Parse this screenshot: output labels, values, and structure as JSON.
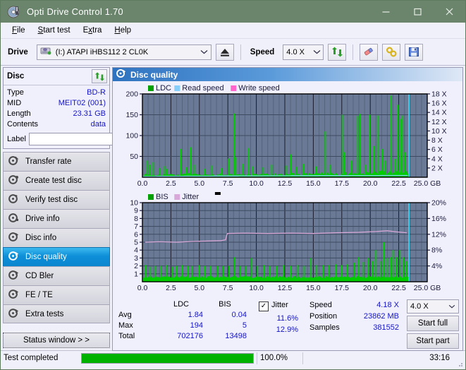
{
  "window": {
    "title": "Opti Drive Control 1.70",
    "icon": "disc-icon",
    "minimize": "—",
    "maximize": "□",
    "close": "✕"
  },
  "menu": [
    {
      "label": "File",
      "accel": "F"
    },
    {
      "label": "Start test",
      "accel": "S"
    },
    {
      "label": "Extra",
      "accel": "x"
    },
    {
      "label": "Help",
      "accel": "H"
    }
  ],
  "toolbar": {
    "drive_label": "Drive",
    "drive_value": "(I:)  ATAPI iHBS112  2 CL0K",
    "eject_icon": "eject-icon",
    "speed_label": "Speed",
    "speed_value": "4.0 X",
    "refresh_icon": "refresh-icon",
    "erase_icon": "eraser-icon",
    "tools_icon": "tools-icon",
    "save_icon": "save-icon"
  },
  "disc": {
    "title": "Disc",
    "refresh_icon": "refresh-icon",
    "rows": [
      {
        "key": "Type",
        "value": "BD-R"
      },
      {
        "key": "MID",
        "value": "MEIT02 (001)"
      },
      {
        "key": "Length",
        "value": "23.31 GB"
      },
      {
        "key": "Contents",
        "value": "data"
      }
    ],
    "label_key": "Label",
    "label_value": "",
    "label_placeholder": "",
    "disc_icon": "disc-icon"
  },
  "sidebar": {
    "items": [
      {
        "label": "Transfer rate",
        "icon": "disc-test-icon",
        "active": false
      },
      {
        "label": "Create test disc",
        "icon": "disc-test-icon",
        "active": false
      },
      {
        "label": "Verify test disc",
        "icon": "disc-test-icon",
        "active": false
      },
      {
        "label": "Drive info",
        "icon": "disc-test-icon",
        "active": false
      },
      {
        "label": "Disc info",
        "icon": "disc-test-icon",
        "active": false
      },
      {
        "label": "Disc quality",
        "icon": "disc-test-icon",
        "active": true
      },
      {
        "label": "CD Bler",
        "icon": "disc-test-icon",
        "active": false
      },
      {
        "label": "FE / TE",
        "icon": "disc-test-icon",
        "active": false
      },
      {
        "label": "Extra tests",
        "icon": "disc-test-icon",
        "active": false
      }
    ],
    "status_window_button": "Status window > >"
  },
  "panel": {
    "title": "Disc quality",
    "icon": "disc-quality-icon"
  },
  "stats": {
    "headers": [
      "LDC",
      "BIS"
    ],
    "rows": [
      {
        "key": "Avg",
        "ldc": "1.84",
        "bis": "0.04",
        "jitter": "11.6%"
      },
      {
        "key": "Max",
        "ldc": "194",
        "bis": "5",
        "jitter": "12.9%"
      },
      {
        "key": "Total",
        "ldc": "702176",
        "bis": "13498",
        "jitter": ""
      }
    ],
    "jitter_label": "Jitter",
    "jitter_checked": true,
    "speed_label": "Speed",
    "speed_value": "4.18 X",
    "position_label": "Position",
    "position_value": "23862 MB",
    "samples_label": "Samples",
    "samples_value": "381552",
    "speed_select": "4.0 X",
    "start_full": "Start full",
    "start_part": "Start part"
  },
  "statusbar": {
    "message": "Test completed",
    "progress_percent": 100.0,
    "progress_text": "100.0%",
    "elapsed": "33:16"
  },
  "chart_data": [
    {
      "type": "line",
      "title": "LDC / Read speed",
      "legend": [
        {
          "name": "LDC",
          "color": "#00a000"
        },
        {
          "name": "Read speed",
          "color": "#87cefa"
        },
        {
          "name": "Write speed",
          "color": "#ff66cc"
        }
      ],
      "legend_position": "top-left",
      "xlabel": "GB",
      "ylabel": "LDC",
      "y2label": "X",
      "xlim": [
        0,
        25
      ],
      "ylim": [
        0,
        200
      ],
      "y2lim": [
        0,
        18
      ],
      "grid": true,
      "xticks": [
        "0.0",
        "2.5",
        "5.0",
        "7.5",
        "10.0",
        "12.5",
        "15.0",
        "17.5",
        "20.0",
        "22.5",
        "25.0 GB"
      ],
      "yticks": [
        50,
        100,
        150,
        200
      ],
      "y2ticks": [
        "2 X",
        "4 X",
        "6 X",
        "8 X",
        "10 X",
        "12 X",
        "14 X",
        "16 X",
        "18 X"
      ],
      "data_end_gb": 23.4,
      "series": [
        {
          "name": "LDC",
          "color": "#00cc00",
          "type": "spike-area",
          "baseline": [
            {
              "x": 0.0,
              "y": 7
            },
            {
              "x": 1.0,
              "y": 6
            },
            {
              "x": 2.0,
              "y": 6
            },
            {
              "x": 3.0,
              "y": 7
            },
            {
              "x": 4.0,
              "y": 8
            },
            {
              "x": 5.0,
              "y": 7
            },
            {
              "x": 6.0,
              "y": 6
            },
            {
              "x": 7.0,
              "y": 7
            },
            {
              "x": 8.0,
              "y": 8
            },
            {
              "x": 9.0,
              "y": 7
            },
            {
              "x": 10.0,
              "y": 7
            },
            {
              "x": 11.0,
              "y": 7
            },
            {
              "x": 12.0,
              "y": 8
            },
            {
              "x": 13.0,
              "y": 8
            },
            {
              "x": 14.0,
              "y": 8
            },
            {
              "x": 15.0,
              "y": 9
            },
            {
              "x": 16.0,
              "y": 9
            },
            {
              "x": 17.0,
              "y": 9
            },
            {
              "x": 18.0,
              "y": 10
            },
            {
              "x": 19.0,
              "y": 11
            },
            {
              "x": 20.0,
              "y": 12
            },
            {
              "x": 21.0,
              "y": 13
            },
            {
              "x": 22.0,
              "y": 13
            },
            {
              "x": 23.0,
              "y": 14
            },
            {
              "x": 23.4,
              "y": 12
            }
          ],
          "spikes": [
            {
              "x": 0.45,
              "y": 40
            },
            {
              "x": 0.62,
              "y": 30
            },
            {
              "x": 0.95,
              "y": 36
            },
            {
              "x": 1.55,
              "y": 22
            },
            {
              "x": 1.95,
              "y": 27
            },
            {
              "x": 2.15,
              "y": 20
            },
            {
              "x": 3.35,
              "y": 68
            },
            {
              "x": 3.85,
              "y": 24
            },
            {
              "x": 4.25,
              "y": 72
            },
            {
              "x": 4.55,
              "y": 30
            },
            {
              "x": 5.45,
              "y": 20
            },
            {
              "x": 6.05,
              "y": 28
            },
            {
              "x": 6.95,
              "y": 22
            },
            {
              "x": 7.55,
              "y": 45
            },
            {
              "x": 8.05,
              "y": 153
            },
            {
              "x": 8.15,
              "y": 48
            },
            {
              "x": 8.85,
              "y": 32
            },
            {
              "x": 9.35,
              "y": 70
            },
            {
              "x": 9.65,
              "y": 26
            },
            {
              "x": 10.6,
              "y": 24
            },
            {
              "x": 11.35,
              "y": 30
            },
            {
              "x": 12.6,
              "y": 28
            },
            {
              "x": 13.05,
              "y": 55
            },
            {
              "x": 13.55,
              "y": 25
            },
            {
              "x": 14.15,
              "y": 32
            },
            {
              "x": 15.25,
              "y": 26
            },
            {
              "x": 16.05,
              "y": 110
            },
            {
              "x": 16.45,
              "y": 30
            },
            {
              "x": 17.55,
              "y": 150
            },
            {
              "x": 17.75,
              "y": 60
            },
            {
              "x": 18.35,
              "y": 40
            },
            {
              "x": 18.9,
              "y": 147
            },
            {
              "x": 19.1,
              "y": 152
            },
            {
              "x": 19.55,
              "y": 30
            },
            {
              "x": 19.95,
              "y": 150
            },
            {
              "x": 20.35,
              "y": 75
            },
            {
              "x": 20.65,
              "y": 148
            },
            {
              "x": 21.05,
              "y": 68
            },
            {
              "x": 21.35,
              "y": 40
            },
            {
              "x": 21.85,
              "y": 196
            },
            {
              "x": 22.15,
              "y": 44
            },
            {
              "x": 22.45,
              "y": 174
            },
            {
              "x": 22.65,
              "y": 140
            },
            {
              "x": 22.85,
              "y": 148
            },
            {
              "x": 23.05,
              "y": 60
            }
          ]
        },
        {
          "name": "Read speed",
          "color": "#87cefa",
          "type": "step-line",
          "points": [
            {
              "x": 0.0,
              "y": 1.75
            },
            {
              "x": 1.2,
              "y": 1.8
            },
            {
              "x": 1.3,
              "y": 2.1
            },
            {
              "x": 3.6,
              "y": 2.15
            },
            {
              "x": 3.7,
              "y": 2.5
            },
            {
              "x": 6.2,
              "y": 2.55
            },
            {
              "x": 6.3,
              "y": 2.85
            },
            {
              "x": 8.4,
              "y": 2.9
            },
            {
              "x": 8.5,
              "y": 3.15
            },
            {
              "x": 10.6,
              "y": 3.2
            },
            {
              "x": 10.7,
              "y": 3.45
            },
            {
              "x": 13.0,
              "y": 3.5
            },
            {
              "x": 13.1,
              "y": 3.7
            },
            {
              "x": 15.4,
              "y": 3.72
            },
            {
              "x": 15.5,
              "y": 3.9
            },
            {
              "x": 18.2,
              "y": 3.92
            },
            {
              "x": 18.3,
              "y": 4.05
            },
            {
              "x": 20.8,
              "y": 4.08
            },
            {
              "x": 20.9,
              "y": 4.2
            },
            {
              "x": 23.3,
              "y": 4.2
            }
          ]
        },
        {
          "name": "marker",
          "color": "#40d8f8",
          "type": "vline",
          "x": 23.4
        }
      ]
    },
    {
      "type": "line",
      "title": "BIS / Jitter",
      "legend": [
        {
          "name": "BIS",
          "color": "#00a000"
        },
        {
          "name": "Jitter",
          "color": "#d8a8d8"
        }
      ],
      "legend_position": "top-left",
      "xlabel": "GB",
      "ylabel": "BIS",
      "y2label": "%",
      "xlim": [
        0,
        25
      ],
      "ylim": [
        0,
        10
      ],
      "y2lim": [
        0,
        20
      ],
      "grid": true,
      "xticks": [
        "0.0",
        "2.5",
        "5.0",
        "7.5",
        "10.0",
        "12.5",
        "15.0",
        "17.5",
        "20.0",
        "22.5",
        "25.0 GB"
      ],
      "yticks": [
        1,
        2,
        3,
        4,
        5,
        6,
        7,
        8,
        9,
        10
      ],
      "y2ticks": [
        "4%",
        "8%",
        "12%",
        "16%",
        "20%"
      ],
      "data_end_gb": 23.4,
      "series": [
        {
          "name": "BIS",
          "color": "#00cc00",
          "type": "spike-area",
          "baseline_value": 1.0,
          "spikes": [
            {
              "x": 0.3,
              "y": 2.1
            },
            {
              "x": 0.7,
              "y": 1.9
            },
            {
              "x": 1.1,
              "y": 2.0
            },
            {
              "x": 1.6,
              "y": 2.0
            },
            {
              "x": 2.1,
              "y": 2.1
            },
            {
              "x": 2.6,
              "y": 1.9
            },
            {
              "x": 3.0,
              "y": 2.0
            },
            {
              "x": 3.5,
              "y": 2.1
            },
            {
              "x": 4.0,
              "y": 2.0
            },
            {
              "x": 4.4,
              "y": 2.0
            },
            {
              "x": 5.0,
              "y": 2.1
            },
            {
              "x": 5.5,
              "y": 2.0
            },
            {
              "x": 6.0,
              "y": 2.0
            },
            {
              "x": 6.6,
              "y": 2.0
            },
            {
              "x": 7.1,
              "y": 2.0
            },
            {
              "x": 7.6,
              "y": 2.0
            },
            {
              "x": 8.1,
              "y": 3.1
            },
            {
              "x": 8.6,
              "y": 2.0
            },
            {
              "x": 9.1,
              "y": 2.0
            },
            {
              "x": 9.6,
              "y": 3.0
            },
            {
              "x": 10.1,
              "y": 2.0
            },
            {
              "x": 10.7,
              "y": 2.1
            },
            {
              "x": 11.2,
              "y": 2.0
            },
            {
              "x": 11.8,
              "y": 2.0
            },
            {
              "x": 12.4,
              "y": 2.1
            },
            {
              "x": 13.0,
              "y": 2.0
            },
            {
              "x": 13.6,
              "y": 2.1
            },
            {
              "x": 14.2,
              "y": 2.0
            },
            {
              "x": 14.8,
              "y": 3.0
            },
            {
              "x": 15.3,
              "y": 2.1
            },
            {
              "x": 15.9,
              "y": 2.1
            },
            {
              "x": 16.4,
              "y": 2.1
            },
            {
              "x": 17.0,
              "y": 2.2
            },
            {
              "x": 17.5,
              "y": 2.1
            },
            {
              "x": 18.0,
              "y": 2.2
            },
            {
              "x": 18.6,
              "y": 2.4
            },
            {
              "x": 19.0,
              "y": 3.1
            },
            {
              "x": 19.4,
              "y": 2.5
            },
            {
              "x": 19.8,
              "y": 3.0
            },
            {
              "x": 20.2,
              "y": 2.6
            },
            {
              "x": 20.5,
              "y": 4.0
            },
            {
              "x": 20.9,
              "y": 2.6
            },
            {
              "x": 21.2,
              "y": 5.0
            },
            {
              "x": 21.5,
              "y": 3.0
            },
            {
              "x": 21.8,
              "y": 3.1
            },
            {
              "x": 22.0,
              "y": 4.0
            },
            {
              "x": 22.3,
              "y": 3.1
            },
            {
              "x": 22.6,
              "y": 4.0
            },
            {
              "x": 22.9,
              "y": 3.1
            },
            {
              "x": 23.2,
              "y": 2.6
            }
          ]
        },
        {
          "name": "Jitter",
          "color": "#d8a8d8",
          "type": "line",
          "points": [
            {
              "x": 0.25,
              "y": 5.0
            },
            {
              "x": 1.5,
              "y": 5.05
            },
            {
              "x": 3.0,
              "y": 5.0
            },
            {
              "x": 4.5,
              "y": 5.1
            },
            {
              "x": 5.8,
              "y": 5.15
            },
            {
              "x": 6.9,
              "y": 5.2
            },
            {
              "x": 7.3,
              "y": 5.3
            },
            {
              "x": 7.45,
              "y": 6.1
            },
            {
              "x": 9.0,
              "y": 6.15
            },
            {
              "x": 11.0,
              "y": 6.1
            },
            {
              "x": 13.0,
              "y": 6.15
            },
            {
              "x": 15.0,
              "y": 6.1
            },
            {
              "x": 17.0,
              "y": 6.2
            },
            {
              "x": 19.0,
              "y": 6.25
            },
            {
              "x": 20.5,
              "y": 6.35
            },
            {
              "x": 21.5,
              "y": 6.45
            },
            {
              "x": 22.3,
              "y": 6.3
            },
            {
              "x": 23.2,
              "y": 6.2
            }
          ]
        },
        {
          "name": "marker",
          "color": "#40d8f8",
          "type": "vline",
          "x": 23.4
        }
      ]
    }
  ]
}
